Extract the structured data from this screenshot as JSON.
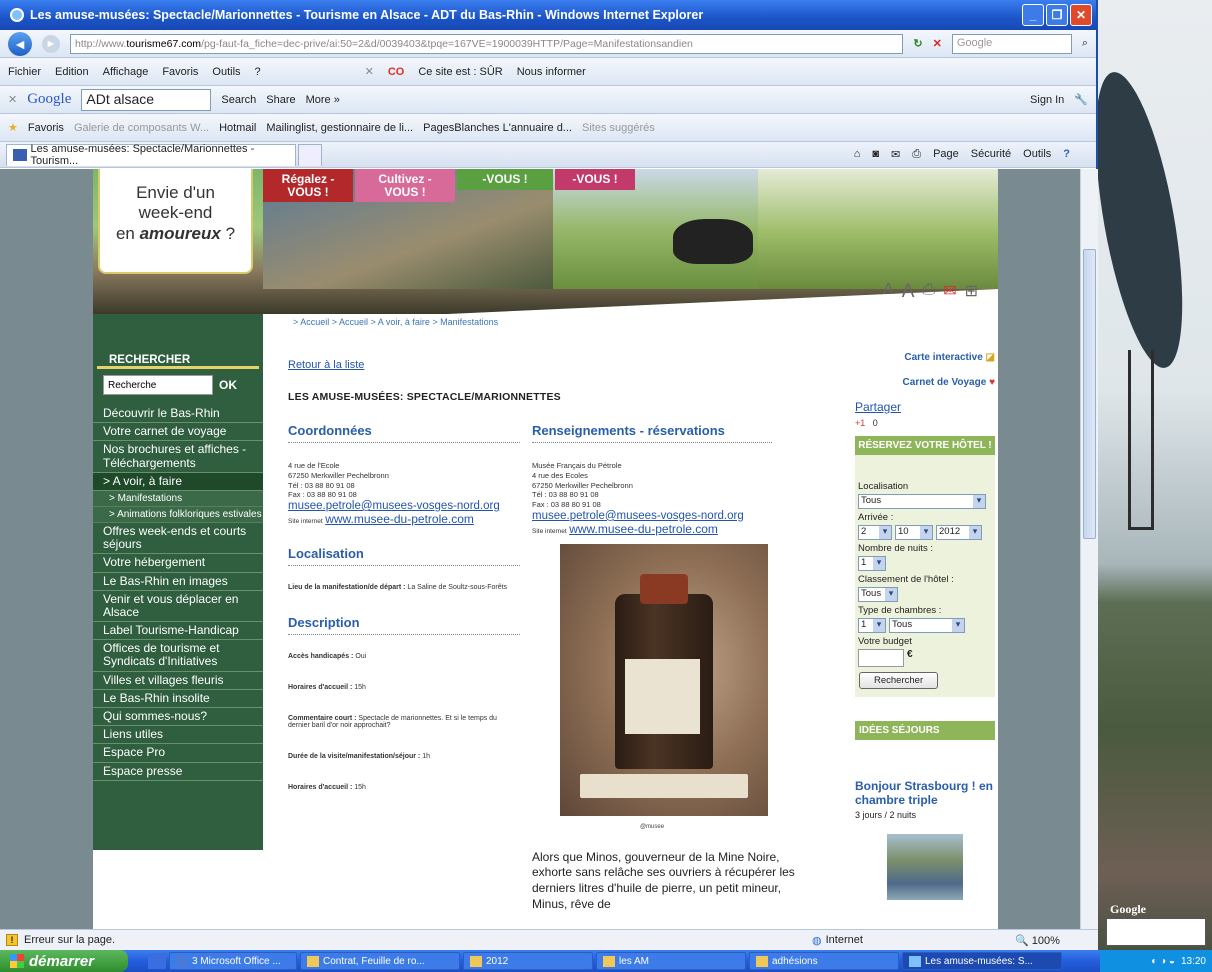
{
  "window": {
    "title": "Les amuse-musées: Spectacle/Marionnettes - Tourisme en Alsace - ADT du Bas-Rhin - Windows Internet Explorer"
  },
  "address": {
    "domain_pre": "http://www.",
    "domain": "tourisme67.com",
    "path": "/pg-faut-fa_fiche=dec-prive/ai:50=2&d/0039403&tpqe=167VE=1900039HTTP/Page=Manifestationsandien"
  },
  "search_box": {
    "placeholder": "Google"
  },
  "menu_bar": {
    "items": [
      "Fichier",
      "Edition",
      "Affichage",
      "Favoris",
      "Outils",
      "?"
    ],
    "safety": "Ce site est : SÛR",
    "inform": "Nous informer"
  },
  "google_bar": {
    "logo": "Google",
    "query": "ADt alsace",
    "search": "Search",
    "share": "Share",
    "more": "More »",
    "sign_in": "Sign In"
  },
  "favorites_bar": {
    "label": "Favoris",
    "items": [
      "Galerie de composants W...",
      "Hotmail",
      "Mailinglist, gestionnaire de li...",
      "PagesBlanches  L'annuaire d...",
      "Sites suggérés"
    ]
  },
  "tab": {
    "title": "Les amuse-musées: Spectacle/Marionnettes - Tourism..."
  },
  "tab_tools": {
    "page": "Page",
    "security": "Sécurité",
    "tools": "Outils"
  },
  "banner": {
    "envie_line1": "Envie d'un",
    "envie_line2": "week-end",
    "envie_line3a": "en ",
    "envie_line3b": "amoureux",
    "envie_line3c": " ?",
    "labels": [
      "Régalez -VOUS !",
      "Cultivez -VOUS !",
      "-VOUS !",
      "-VOUS !"
    ]
  },
  "breadcrumb": "> Accueil > Accueil > A voir, à faire > Manifestations",
  "sidebar": {
    "search_title": "RECHERCHER",
    "search_placeholder": "Recherche",
    "search_ok": "OK",
    "items": [
      "Découvrir le Bas-Rhin",
      "Votre carnet de voyage",
      "Nos brochures et affiches - Téléchargements",
      "> A voir, à faire",
      "> Manifestations",
      "> Animations folkloriques estivales",
      "Offres week-ends et courts séjours",
      "Votre hébergement",
      "Le Bas-Rhin en images",
      "Venir et vous déplacer en Alsace",
      "Label Tourisme-Handicap",
      "Offices de tourisme et Syndicats d'Initiatives",
      "Villes et villages fleuris",
      "Le Bas-Rhin insolite",
      "Qui sommes-nous?",
      "Liens utiles",
      "Espace Pro",
      "Espace presse"
    ]
  },
  "main": {
    "back_link": "Retour à la liste",
    "heading": "LES AMUSE-MUSÉES: SPECTACLE/MARIONNETTES",
    "coord_title": "Coordonnées",
    "coord_lines": [
      "4 rue de l'Ecole",
      "67250 Merkwiller Pechelbronn",
      "Tél : 03 88 80 91 08",
      "Fax : 03 88 80 91 08"
    ],
    "coord_email": "musee.petrole@musees-vosges-nord.org",
    "coord_web_label": "Site internet",
    "coord_web": "www.musee-du-petrole.com",
    "loc_title": "Localisation",
    "loc_label": "Lieu de la manifestation/de départ :",
    "loc_value": "La Saline de Soultz-sous-Forêts",
    "desc_title": "Description",
    "desc_access_label": "Accès handicapés :",
    "desc_access_value": "Oui",
    "desc_hours_label": "Horaires d'accueil :",
    "desc_hours_value": "15h",
    "desc_comment_label": "Commentaire court :",
    "desc_comment_value": "Spectacle de marionnettes. Et si le temps du dernier baril d'or noir approchait?",
    "desc_duration_label": "Durée de la visite/manifestation/séjour :",
    "desc_duration_value": "1h",
    "desc_hours2_label": "Horaires d'accueil :",
    "desc_hours2_value": "15h",
    "info_title": "Renseignements - réservations",
    "info_lines": [
      "Musée Français du Pétrole",
      "4 rue des Ecoles",
      "67250 Merkwiller Pechelbronn",
      "Tél : 03 88 80 91 08",
      "Fax : 03 88 80 91 08"
    ],
    "info_email": "musee.petrole@musees-vosges-nord.org",
    "info_web_label": "Site internet",
    "info_web": "www.musee-du-petrole.com",
    "photo_caption": "@musee",
    "story": "Alors que Minos, gouverneur de la Mine Noire, exhorte sans relâche ses ouvriers à récupérer les derniers litres d'huile de pierre, un petit mineur, Minus, rêve de"
  },
  "right": {
    "carte": "Carte interactive",
    "carnet": "Carnet de Voyage",
    "partager": "Partager",
    "gplus": "+1",
    "gplus_count": "0",
    "hotel_title": "RÉSERVEZ VOTRE HÔTEL !",
    "loc_label": "Localisation",
    "loc_value": "Tous",
    "arrival_label": "Arrivée :",
    "day": "2",
    "month": "10",
    "year": "2012",
    "nights_label": "Nombre de nuits :",
    "nights": "1",
    "class_label": "Classement de l'hôtel :",
    "class_value": "Tous",
    "room_label": "Type de chambres :",
    "room_count": "1",
    "room_type": "Tous",
    "budget_label": "Votre budget",
    "currency": "€",
    "search_btn": "Rechercher",
    "ideas": "IDÉES SÉJOURS",
    "promo_title": "Bonjour Strasbourg ! en chambre triple",
    "promo_sub": "3 jours / 2 nuits"
  },
  "status": {
    "text": "Erreur sur la page.",
    "zone": "Internet",
    "zoom": "100%"
  },
  "taskbar": {
    "start": "démarrer",
    "items": [
      "3 Microsoft Office ...",
      "Contrat, Feuille de ro...",
      "2012",
      "les AM",
      "adhésions",
      "Les amuse-musées: S..."
    ],
    "clock": "13:20"
  },
  "desktop": {
    "widget_logo": "Google"
  }
}
